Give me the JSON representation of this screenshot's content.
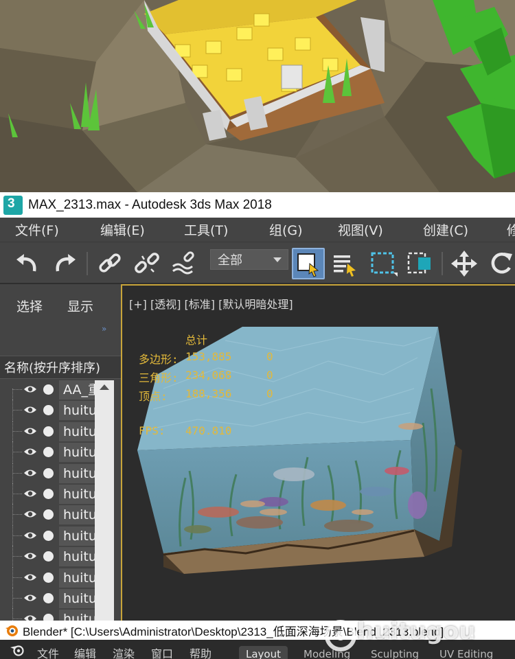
{
  "max_window": {
    "app_icon_glyph": "3",
    "title": "MAX_2313.max - Autodesk 3ds Max 2018",
    "menu": [
      "文件(F)",
      "编辑(E)",
      "工具(T)",
      "组(G)",
      "视图(V)",
      "创建(C)",
      "修"
    ],
    "toolbar": {
      "selection_filter": "全部",
      "icons": [
        "undo-icon",
        "redo-icon",
        "link-icon",
        "unlink-icon",
        "bind-spacewarp-icon",
        "select-object-icon",
        "select-by-name-icon",
        "rectangular-selection-icon",
        "window-crossing-icon",
        "move-icon",
        "rotate-icon"
      ]
    },
    "scene_explorer": {
      "tabs": [
        "选择",
        "显示"
      ],
      "expand_glyph": "»",
      "column_header": "名称(按升序排序)",
      "rows": [
        "AA_重",
        "huitu",
        "huitu",
        "huitu",
        "huitu",
        "huitu",
        "huitu",
        "huitu",
        "huitu",
        "huitu",
        "huitu",
        "huitu"
      ]
    },
    "viewport": {
      "label": "[+] [透视] [标准] [默认明暗处理]",
      "stats": {
        "total_label": "总计",
        "rows": [
          {
            "label": "多边形:",
            "value": "153,885",
            "selected": "0"
          },
          {
            "label": "三角形:",
            "value": "234,068",
            "selected": "0"
          },
          {
            "label": "顶点:",
            "value": "188,356",
            "selected": "0"
          }
        ],
        "fps_label": "FPS:",
        "fps_value": "470.810"
      }
    }
  },
  "blender_window": {
    "title": "Blender* [C:\\Users\\Administrator\\Desktop\\2313_低面深海场景\\Blend_2313.blend]",
    "menu": [
      "文件",
      "编辑",
      "渲染",
      "窗口",
      "帮助"
    ],
    "workspace_tabs": [
      "Layout",
      "Modeling",
      "Sculpting",
      "UV Editing"
    ],
    "active_tab": "Layout"
  },
  "watermark": {
    "text": "huitugou",
    "suffix": ".com"
  },
  "colors": {
    "max_menu_bg": "#444444",
    "viewport_border": "#c9a53a",
    "stats_text": "#e3b93a",
    "selected_tool": "#5b86b8",
    "teal_icon": "#1ea6a6"
  }
}
